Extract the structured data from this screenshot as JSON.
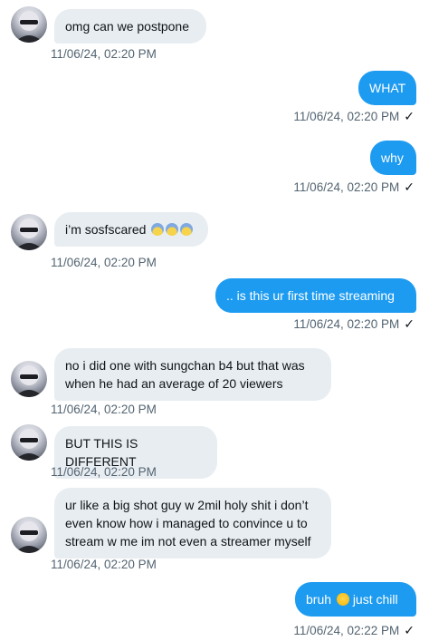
{
  "messages": [
    {
      "text": "omg can we postpone",
      "time": "11/06/24, 02:20 PM"
    },
    {
      "text": "WHAT",
      "time": "11/06/24, 02:20 PM"
    },
    {
      "text": "why",
      "time": "11/06/24, 02:20 PM"
    },
    {
      "text": "i’m sosfscared",
      "time": "11/06/24, 02:20 PM"
    },
    {
      "text": ".. is this ur first time streaming",
      "time": "11/06/24, 02:20 PM"
    },
    {
      "text": "no i did one with sungchan b4 but that was when he had an average of 20 viewers",
      "time": "11/06/24, 02:20 PM"
    },
    {
      "text": "BUT THIS IS DIFFERENT",
      "time": "11/06/24, 02:20 PM"
    },
    {
      "text": "ur like a big shot guy w 2mil holy shit i don’t even know how i managed to convince u to stream w me im not even a streamer myself",
      "time": "11/06/24, 02:20 PM"
    },
    {
      "text_a": "bruh",
      "text_b": "just chill",
      "time": "11/06/24, 02:22 PM"
    }
  ],
  "read_mark": "✓",
  "icons": {
    "scared": "fearful-face-emoji-icon",
    "drool": "drooling-face-emoji-icon"
  },
  "colors": {
    "incoming_bubble": "#e8edf1",
    "outgoing_bubble": "#1d9bf0",
    "timestamp": "#536471"
  }
}
